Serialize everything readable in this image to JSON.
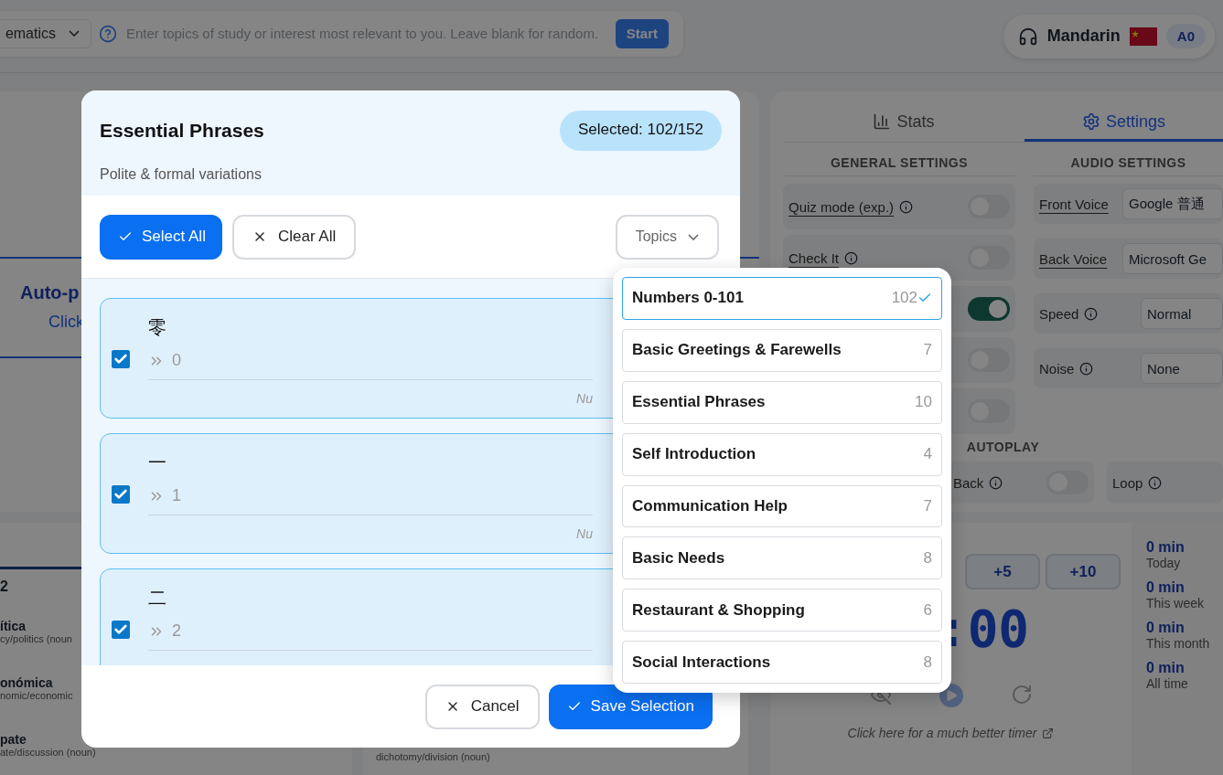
{
  "top_bar": {
    "subject_select": "ematics",
    "topic_field": {
      "placeholder": "Enter topics of study or interest most relevant to you. Leave blank for random."
    },
    "start_button": "Start",
    "language": {
      "name": "Mandarin",
      "cefr": "A0"
    }
  },
  "main_card": {
    "title": "Auto-p",
    "subtitle": "Click"
  },
  "word_list": {
    "tab": "2",
    "words": [
      {
        "word": "ítica",
        "meaning": "cy/politics (noun"
      },
      {
        "word": "onómica",
        "meaning": "nomic/economic"
      },
      {
        "word": "pate",
        "meaning": "ate/discussion (noun)"
      }
    ]
  },
  "word_list_2": {
    "meaning": "dichotomy/division (noun)"
  },
  "side_panel": {
    "tabs": [
      {
        "label": "Stats",
        "selected": false
      },
      {
        "label": "Settings",
        "selected": true
      }
    ],
    "general": {
      "heading": "GENERAL SETTINGS",
      "rows": [
        {
          "label": "Quiz mode (exp.)",
          "on": false
        },
        {
          "label": "Check It",
          "on": false
        },
        {
          "on": true
        },
        {
          "on": false
        },
        {
          "on": false
        }
      ]
    },
    "audio": {
      "heading": "AUDIO SETTINGS",
      "rows": [
        {
          "label": "Front Voice",
          "value": "Google 普通",
          "info": false
        },
        {
          "label": "Back Voice",
          "value": "Microsoft Ge",
          "info": false
        },
        {
          "label": "Speed",
          "value": "Normal",
          "info": true
        },
        {
          "label": "Noise",
          "value": "None",
          "info": true
        }
      ]
    },
    "autoplay": {
      "heading": "AUTOPLAY",
      "rows": [
        {
          "label": "Back",
          "on": false
        },
        {
          "label": "Loop"
        }
      ]
    }
  },
  "timer": {
    "buttons": [
      "+5",
      "+10"
    ],
    "display": ":00",
    "link": "Click here for a much better timer",
    "stats": [
      {
        "value": "0",
        "unit": "min",
        "label": "Today"
      },
      {
        "value": "0",
        "unit": "min",
        "label": "This week"
      },
      {
        "value": "0",
        "unit": "min",
        "label": "This month"
      },
      {
        "value": "0",
        "unit": "min",
        "label": "All time"
      }
    ]
  },
  "modal": {
    "title": "Essential Phrases",
    "subtitle": "Polite & formal variations",
    "badge": "Selected: 102/152",
    "select_all": "Select All",
    "clear_all": "Clear All",
    "topics_button": "Topics",
    "cards": [
      {
        "word": "零",
        "translation": "0",
        "category": "Nu",
        "checked": true
      },
      {
        "word": "一",
        "translation": "1",
        "category": "Nu",
        "checked": true
      },
      {
        "word": "二",
        "translation": "2",
        "checked": true
      }
    ],
    "cancel": "Cancel",
    "save": "Save Selection"
  },
  "topics_menu": {
    "items": [
      {
        "label": "Numbers 0-101",
        "count": "102",
        "selected": true
      },
      {
        "label": "Basic Greetings & Farewells",
        "count": "7",
        "selected": false
      },
      {
        "label": "Essential Phrases",
        "count": "10",
        "selected": false
      },
      {
        "label": "Self Introduction",
        "count": "4",
        "selected": false
      },
      {
        "label": "Communication Help",
        "count": "7",
        "selected": false
      },
      {
        "label": "Basic Needs",
        "count": "8",
        "selected": false
      },
      {
        "label": "Restaurant & Shopping",
        "count": "6",
        "selected": false
      },
      {
        "label": "Social Interactions",
        "count": "8",
        "selected": false
      }
    ]
  }
}
